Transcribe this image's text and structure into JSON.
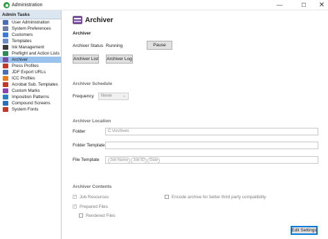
{
  "window": {
    "title": "Administration",
    "min_glyph": "—",
    "max_glyph": "☐",
    "close_glyph": "✕"
  },
  "sidebar": {
    "header": "Admin Tasks",
    "items": [
      {
        "label": "User Administration",
        "icon": "users-icon",
        "color": "#4a6fb5"
      },
      {
        "label": "System Preferences",
        "icon": "preferences-icon",
        "color": "#6d7fa8"
      },
      {
        "label": "Customers",
        "icon": "customers-icon",
        "color": "#3b7bd4"
      },
      {
        "label": "Templates",
        "icon": "templates-icon",
        "color": "#6b8cc4"
      },
      {
        "label": "Ink Management",
        "icon": "ink-icon",
        "color": "#3a3a3a"
      },
      {
        "label": "Preflight and Action Lists",
        "icon": "preflight-icon",
        "color": "#2e8b57"
      },
      {
        "label": "Archiver",
        "icon": "archiver-icon",
        "color": "#7a4fa0",
        "selected": true
      },
      {
        "label": "Press Profiles",
        "icon": "press-icon",
        "color": "#c0392b"
      },
      {
        "label": "JDF Export URLs",
        "icon": "jdf-icon",
        "color": "#4a6fb5"
      },
      {
        "label": "ICC Profiles",
        "icon": "icc-icon",
        "color": "#e67e22"
      },
      {
        "label": "Acrobat Sub. Templates",
        "icon": "acrobat-icon",
        "color": "#c0392b"
      },
      {
        "label": "Custom Marks",
        "icon": "marks-icon",
        "color": "#8e44ad"
      },
      {
        "label": "Imposition Patterns",
        "icon": "imposition-icon",
        "color": "#2c80b9"
      },
      {
        "label": "Compound Screens",
        "icon": "screens-icon",
        "color": "#2c6fb9"
      },
      {
        "label": "System Fonts",
        "icon": "font-icon",
        "color": "#c0392b"
      }
    ]
  },
  "main": {
    "title": "Archiver",
    "archiver": {
      "section_title": "Archiver",
      "status_label": "Archiver Status",
      "status_value": "Running",
      "pause_label": "Pause",
      "list_label": "Archiver List",
      "log_label": "Archiver Log"
    },
    "schedule": {
      "section_title": "Archiver Schedule",
      "frequency_label": "Frequency",
      "frequency_value": "Never"
    },
    "location": {
      "section_title": "Archiver Location",
      "folder_label": "Folder",
      "folder_value": "C:\\Archives",
      "folder_template_label": "Folder Template",
      "file_template_label": "File Template",
      "file_template_tokens": [
        "Job Name",
        "Job ID",
        "Date"
      ]
    },
    "contents": {
      "section_title": "Archiver Contents",
      "job_resources": "Job Resources",
      "prepared_files": "Prepared Files",
      "rendered_files": "Rendered Files",
      "encode": "Encode archive for better third party compatibility"
    },
    "edit_settings_label": "Edit Settings"
  }
}
